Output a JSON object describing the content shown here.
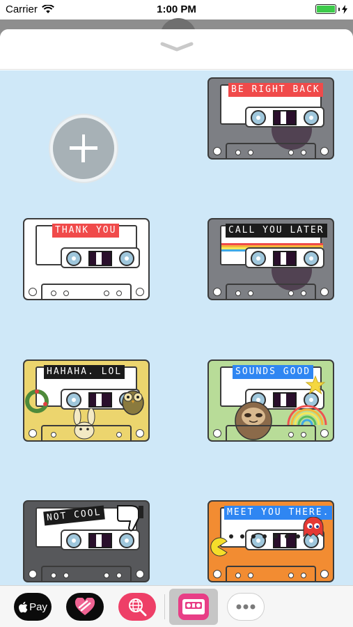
{
  "status_bar": {
    "carrier": "Carrier",
    "time": "1:00 PM"
  },
  "colors": {
    "sticker_background": "#cfe8f8",
    "white_cassette": "#ffffff",
    "gray_cassette": "#7d7f84",
    "yellow_cassette": "#ecd56e",
    "green_cassette": "#b8dc98",
    "dark_cassette": "#57585b",
    "orange_cassette": "#f28c32",
    "label_red": "#f04a4a",
    "label_black": "#1b1b1b",
    "label_blue": "#2f86f2"
  },
  "add_sticker": {
    "icon": "plus-icon"
  },
  "stickers": [
    {
      "text": "BE RIGHT BACK",
      "body_color": "#7d7f84",
      "label_color": "#f04a4a",
      "decoration": "shadow-disc"
    },
    {
      "text": "THANK YOU",
      "body_color": "#ffffff",
      "label_color": "#f04a4a",
      "decoration": "none"
    },
    {
      "text": "CALL YOU LATER",
      "body_color": "#7d7f84",
      "label_color": "#1b1b1b",
      "decoration": "rainbow-stripes"
    },
    {
      "text": "HAHAHA. LOL",
      "body_color": "#ecd56e",
      "label_color": "#1b1b1b",
      "decoration": "owl-and-wreath"
    },
    {
      "text": "SOUNDS GOOD",
      "body_color": "#b8dc98",
      "label_color": "#2f86f2",
      "decoration": "sloth-rainbow-star"
    },
    {
      "text": "NOT COOL",
      "body_color": "#57585b",
      "label_color": "#1b1b1b",
      "decoration": "thumbs-down"
    },
    {
      "text": "MEET YOU THERE.",
      "body_color": "#f28c32",
      "label_color": "#2f86f2",
      "decoration": "pacman-ghost"
    }
  ],
  "app_drawer": {
    "apple_pay_label": "Pay",
    "apple_pay_icon": "apple-icon",
    "digital_touch_icon": "heart-icon",
    "images_icon": "globe-search-icon",
    "cassette_app_icon": "cassette-app-icon",
    "more_icon": "ellipsis-icon"
  }
}
